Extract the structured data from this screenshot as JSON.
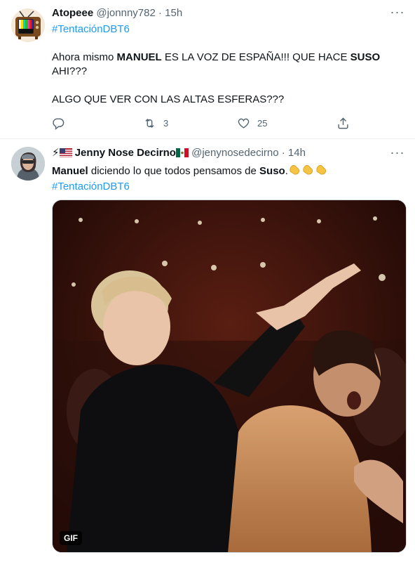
{
  "tweets": [
    {
      "author": "Atopeee",
      "handle": "@jonnny782",
      "time": "15h",
      "hashtag": "#TentaciónDBT6",
      "line1_a": "Ahora mismo ",
      "line1_b": "MANUEL",
      "line1_c": " ES LA VOZ DE ESPAÑA!!! QUE HACE ",
      "line1_d": "SUSO",
      "line2": "AHI???",
      "line3": "ALGO QUE VER CON LAS ALTAS ESFERAS???",
      "retweets": "3",
      "likes": "25",
      "avatar_icon": "retro-tv-icon"
    },
    {
      "author_prefix": "⚡",
      "author": "Jenny Nose Decirno",
      "handle": "@jenynosedecirno",
      "time": "14h",
      "text_a": "Manuel",
      "text_b": " diciendo lo que todos pensamos de ",
      "text_c": "Suso",
      "text_d": ".",
      "hashtag": "#TentaciónDBT6",
      "media_badge": "GIF",
      "avatar_icon": "person-avatar-icon"
    }
  ],
  "ui": {
    "dot": "·",
    "more": "···"
  },
  "colors": {
    "accent": "#1d9bf0",
    "muted": "#536471",
    "text": "#0f1419"
  }
}
